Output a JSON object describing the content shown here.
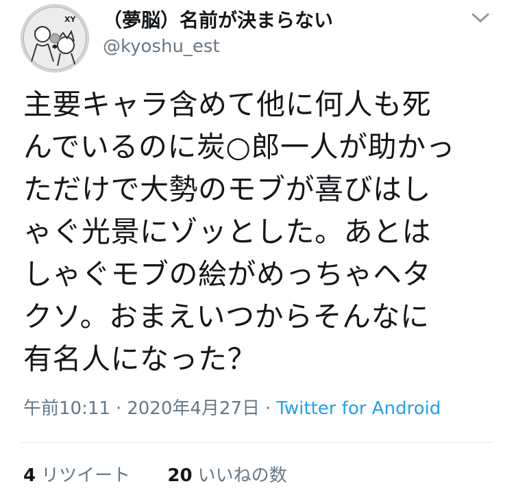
{
  "user": {
    "display_name": "（夢脳）名前が決まらない",
    "handle": "@kyoshu_est",
    "avatar_icon": "avatar-illustration-icon",
    "avatar_text": "XY"
  },
  "tweet": {
    "text": "主要キャラ含めて他に何人も死\nんでいるのに炭○郎一人が助かっ\nただけで大勢のモブが喜びはし\nゃぐ光景にゾッとした。あとは\nしゃぐモブの絵がめっちゃヘタ\nクソ。おまえいつからそんなに\n有名人になった？",
    "time": "午前10:11",
    "date": "2020年4月27日",
    "separator": "·",
    "source": "Twitter for Android"
  },
  "stats": {
    "retweets_count": "4",
    "retweets_label": "リツイート",
    "likes_count": "20",
    "likes_label": "いいねの数"
  },
  "icons": {
    "menu": "chevron-down-icon"
  },
  "colors": {
    "link": "#1da1f2",
    "secondary_text": "#657786",
    "primary_text": "#14171a",
    "divider": "#e1e8ed"
  }
}
